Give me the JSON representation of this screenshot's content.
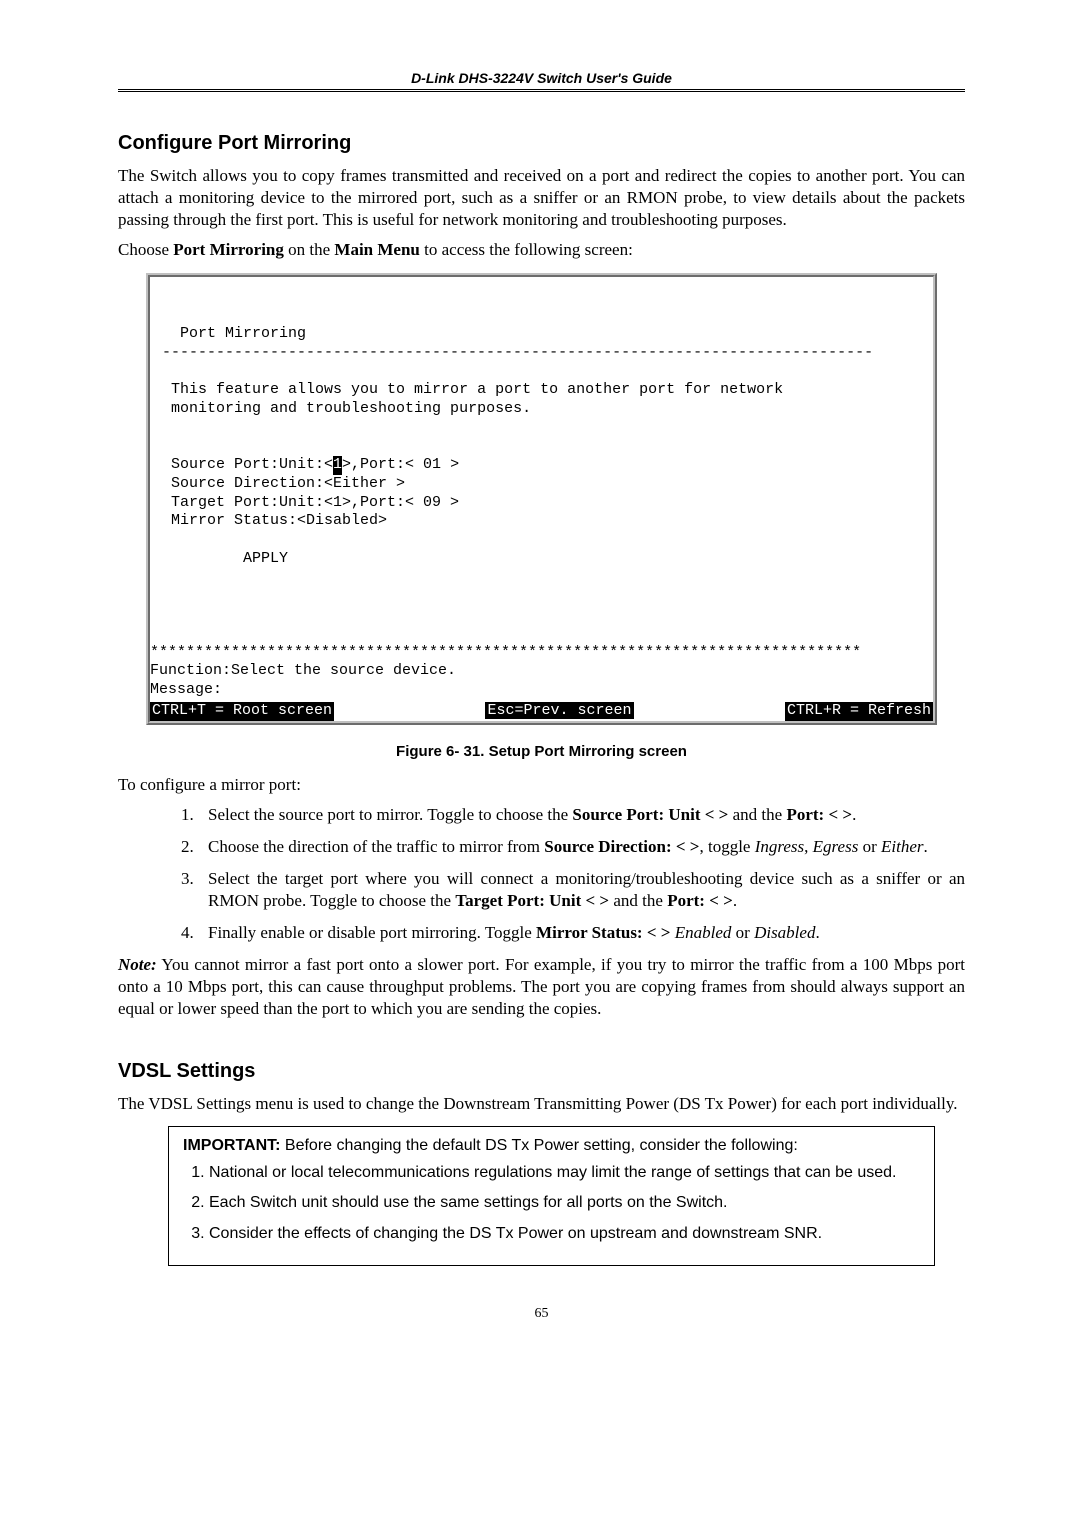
{
  "header": "D-Link DHS-3224V Switch User's Guide",
  "section1": {
    "title": "Configure Port Mirroring",
    "p1": "The Switch allows you to copy frames transmitted and received on a port and redirect the copies to another port. You can attach a monitoring device to the mirrored port, such as a sniffer or an RMON probe, to view details about the packets passing through the first port. This is useful for network monitoring and troubleshooting purposes.",
    "p2_pre": "Choose ",
    "p2_b1": "Port Mirroring",
    "p2_mid": " on the ",
    "p2_b2": "Main Menu",
    "p2_post": " to access the following screen:"
  },
  "terminal": {
    "title": "Port Mirroring",
    "rule": "-------------------------------------------------------------------------------",
    "desc1": "This feature allows you to mirror a port to another port for network",
    "desc2": "monitoring and troubleshooting purposes.",
    "src_line_pre": "Source Port:Unit:<",
    "src_line_cur": "1",
    "src_line_post": ">,Port:< 01 >",
    "src_dir": "Source Direction:<Either >",
    "tgt": "Target Port:Unit:<1>,Port:< 09 >",
    "status": "Mirror Status:<Disabled>",
    "apply": "         APPLY",
    "stars": "*******************************************************************************",
    "func": "Function:Select the source device.",
    "msg": "Message:",
    "sb_left": "CTRL+T = Root screen",
    "sb_mid": "Esc=Prev. screen",
    "sb_right": "CTRL+R = Refresh"
  },
  "figcap": "Figure 6- 31.  Setup Port Mirroring screen",
  "config_intro": "To configure a mirror port:",
  "steps": {
    "s1_a": "Select the source port to mirror. Toggle to choose the ",
    "s1_b1": "Source Port: Unit < >",
    "s1_c": " and the ",
    "s1_b2": "Port: <  >",
    "s1_d": ".",
    "s2_a": "Choose the direction of the traffic to mirror from ",
    "s2_b1": "Source Direction: <  >",
    "s2_c": ", toggle ",
    "s2_i1": "Ingress",
    "s2_d": ", ",
    "s2_i2": "Egress",
    "s2_e": " or ",
    "s2_i3": "Either",
    "s2_f": ".",
    "s3_a": "Select the target port where you will connect a monitoring/troubleshooting device such as a sniffer or an RMON probe. Toggle to choose the ",
    "s3_b1": "Target Port: Unit < >",
    "s3_c": " and the ",
    "s3_b2": "Port: <  >",
    "s3_d": ".",
    "s4_a": "Finally enable or disable port mirroring. Toggle ",
    "s4_b1": "Mirror Status: <   >",
    "s4_c": " ",
    "s4_i1": "Enabled",
    "s4_d": " or ",
    "s4_i2": "Disabled",
    "s4_e": "."
  },
  "note": {
    "label": "Note:",
    "text": "   You cannot mirror a fast port onto a slower port. For example, if you try to mirror the traffic from a 100 Mbps port onto a 10 Mbps port, this can cause throughput problems. The port you are copying frames from should always support an equal or lower speed than the port to which you are sending the copies."
  },
  "section2": {
    "title": "VDSL Settings",
    "p1": "The VDSL Settings menu is used to change the Downstream Transmitting Power (DS Tx Power) for each port individually."
  },
  "important": {
    "heading_b": "IMPORTANT:",
    "heading_rest": " Before changing the default DS Tx Power setting, consider the following:",
    "i1": "National or local telecommunications regulations may limit the range of settings that can be used.",
    "i2": "Each Switch unit should use the same settings for all ports on the Switch.",
    "i3": "Consider the effects of changing the DS Tx Power on upstream and downstream SNR."
  },
  "page_number": "65"
}
